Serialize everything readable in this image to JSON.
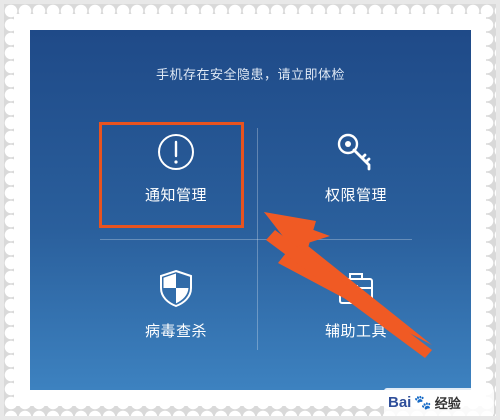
{
  "screen": {
    "header_text": "手机存在安全隐患，请立即体检"
  },
  "tiles": [
    {
      "label": "通知管理",
      "icon": "alert-circle-icon"
    },
    {
      "label": "权限管理",
      "icon": "key-icon"
    },
    {
      "label": "病毒查杀",
      "icon": "shield-icon"
    },
    {
      "label": "辅助工具",
      "icon": "toolbox-icon"
    }
  ],
  "annotation": {
    "highlight_color": "#e8531f",
    "arrow_color": "#f05a24"
  },
  "watermark": {
    "brand": "Bai",
    "paw": "🐾",
    "text": "经验"
  }
}
